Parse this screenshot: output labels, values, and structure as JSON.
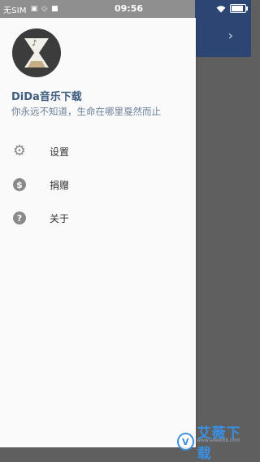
{
  "status_bar": {
    "carrier": "无SIM",
    "time": "09:56",
    "icons": [
      "sim-icon",
      "vibrate-icon",
      "notification-icon",
      "wifi-icon",
      "battery-icon"
    ]
  },
  "background": {
    "toolbar_color": "#2c4573",
    "chevron": "›"
  },
  "drawer": {
    "title": "DiDa音乐下载",
    "slogan": "你永远不知道，生命在哪里戛然而止",
    "items": [
      {
        "label": "设置",
        "icon": "settings-gear-icon"
      },
      {
        "label": "捐赠",
        "icon": "dollar-coin-icon"
      },
      {
        "label": "关于",
        "icon": "help-question-icon"
      }
    ]
  },
  "watermark": {
    "text": "艾薇下载",
    "sub": "www.aiweibk.com"
  }
}
